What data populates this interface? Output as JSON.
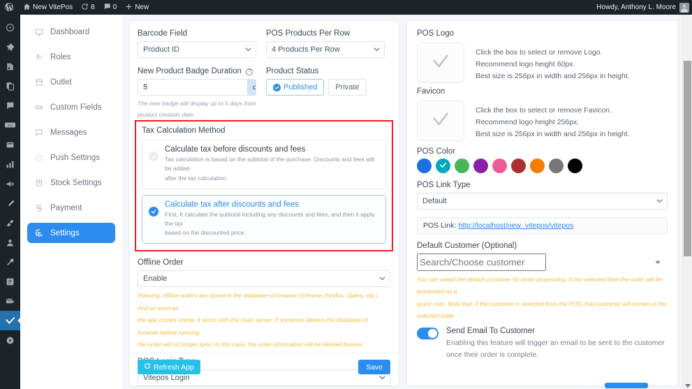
{
  "adminbar": {
    "logo_icon": "wordpress-icon",
    "site_name": "New VitePos",
    "updates_icon": "updates-icon",
    "updates_count": "8",
    "comments_icon": "comments-icon",
    "comments_count": "0",
    "new_icon": "plus-icon",
    "new_label": "New",
    "howdy": "Howdy, Anthony L. Moore"
  },
  "rail": {
    "items": [
      {
        "icon": "dashboard-icon"
      },
      {
        "icon": "pin-icon"
      },
      {
        "icon": "media-icon"
      },
      {
        "icon": "pages-icon"
      },
      {
        "icon": "comments-icon"
      },
      {
        "icon": "woocommerce-icon"
      },
      {
        "icon": "products-icon"
      },
      {
        "icon": "analytics-icon"
      },
      {
        "icon": "marketing-icon"
      },
      {
        "icon": "appearance-icon"
      },
      {
        "icon": "plugins-icon"
      },
      {
        "icon": "users-icon"
      },
      {
        "icon": "tools-icon"
      },
      {
        "icon": "settings-icon"
      },
      {
        "icon": "mail-icon"
      },
      {
        "icon": "vitepos-icon",
        "active": true
      },
      {
        "icon": "media-player-icon"
      }
    ]
  },
  "sidebar": {
    "items": [
      {
        "label": "Dashboard",
        "icon": "dashboard-icon",
        "active": false
      },
      {
        "label": "Roles",
        "icon": "roles-icon",
        "active": false
      },
      {
        "label": "Outlet",
        "icon": "outlet-icon",
        "active": false
      },
      {
        "label": "Custom Fields",
        "icon": "custom-fields-icon",
        "active": false
      },
      {
        "label": "Messages",
        "icon": "messages-icon",
        "active": false
      },
      {
        "label": "Push Settings",
        "icon": "push-settings-icon",
        "active": false
      },
      {
        "label": "Stock Settings",
        "icon": "stock-settings-icon",
        "active": false
      },
      {
        "label": "Payment",
        "icon": "payment-icon",
        "active": false
      },
      {
        "label": "Settings",
        "icon": "settings-gear-icon",
        "active": true
      }
    ]
  },
  "left_panel": {
    "barcode": {
      "label": "Barcode Field",
      "value": "Product ID"
    },
    "products_per_row": {
      "label": "POS Products Per Row",
      "value": "4 Products Per Row"
    },
    "badge_duration": {
      "label": "New Product Badge Duration",
      "help_icon": "question-circle-icon",
      "value": "5",
      "suffix": "days",
      "hint_line1": "The new badge will display up to 5 days from",
      "hint_line2": "product creation date."
    },
    "product_status": {
      "label": "Product Status",
      "options": [
        {
          "label": "Published",
          "selected": true
        },
        {
          "label": "Private",
          "selected": false
        }
      ]
    },
    "tax": {
      "title": "Tax Calculation Method",
      "options": [
        {
          "title": "Calculate tax before discounts and fees",
          "desc_line1": "Tax calculation is based on the subtotal of the purchase. Discounts and fees will be added",
          "desc_line2": "after the tax calculation.",
          "selected": false
        },
        {
          "title": "Calculate tax after discounts and fees",
          "desc_line1": "First, It calculate the subtotal including any discounts and fees, and then it apply the tax",
          "desc_line2": "based on the discounted price.",
          "selected": true
        }
      ],
      "highlight_color": "#ee1c25"
    },
    "offline_order": {
      "label": "Offline Order",
      "value": "Enable",
      "warning_line1": "Warning, offline orders are stored in the database of browser (Chrome, Firefox, Opera, etc.) . And as soon as",
      "warning_line2": "the app comes online, it syncs with the main server. If someone deletes the database of browser before syncing,",
      "warning_line3": "the order will no longer sync. In this case, the order information will be deleted forever."
    },
    "login_type": {
      "label": "POS Login Type",
      "value": "Vitepos Login"
    },
    "footer": {
      "refresh_icon": "refresh-icon",
      "refresh_label": "Refresh App",
      "save_label": "Save"
    }
  },
  "right_panel": {
    "pos_logo": {
      "label": "POS Logo",
      "box_icon": "check-icon",
      "line1": "Click the box to select or remove Logo.",
      "line2": "Recommend logo height 60px.",
      "line3": "Best size is 256px in width and 256px in height."
    },
    "favicon": {
      "label": "Favicon",
      "box_icon": "check-icon",
      "line1": "Click the box to select or remove Favicon.",
      "line2": "Recommend logo height 256px.",
      "line3": "Best size is 256px in width and 256px in height."
    },
    "pos_color": {
      "label": "POS Color",
      "selected_index": 1,
      "check_icon": "check-icon",
      "swatches": [
        "#1e6fe0",
        "#00a8bf",
        "#48b55c",
        "#8b20a8",
        "#ef5a9b",
        "#ab2f2f",
        "#f57c00",
        "#777777",
        "#000000"
      ]
    },
    "link_type": {
      "label": "POS Link Type",
      "value": "Default"
    },
    "pos_link": {
      "prefix": "POS Link:",
      "url": "http://localhost/new_vitepos/vitepos"
    },
    "default_customer": {
      "label": "Default Customer (Optional)",
      "placeholder": "Search/Choose customer",
      "note_line1": "You can select the default customer for order processing. If not selected then the order will be processed as a",
      "note_line2": "guest user. Note that, if the customer is selected from the POS, that customer will remain in the selected state."
    },
    "send_email": {
      "enabled": true,
      "title": "Send Email To Customer",
      "desc_line1": "Enabling this feature will trigger an email to be sent to the customer",
      "desc_line2": "once their order is complete."
    }
  }
}
